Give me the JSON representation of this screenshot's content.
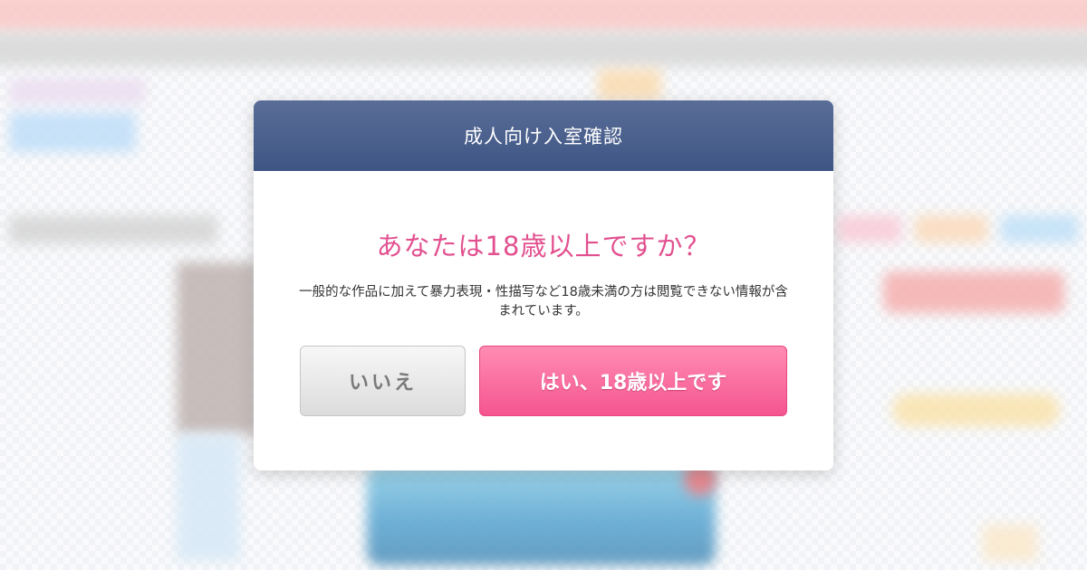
{
  "modal": {
    "title": "成人向け入室確認",
    "question": "あなたは18歳以上ですか？",
    "description": "一般的な作品に加えて暴力表現・性描写など18歳未満の方は閲覧できない情報が含まれています。",
    "no_button": "いいえ",
    "yes_button": "はい、18歳以上です"
  },
  "colors": {
    "header": "#4a5f8e",
    "question_text": "#e2508f",
    "yes_button": "#f76a9c",
    "no_button": "#e8e8e8"
  }
}
